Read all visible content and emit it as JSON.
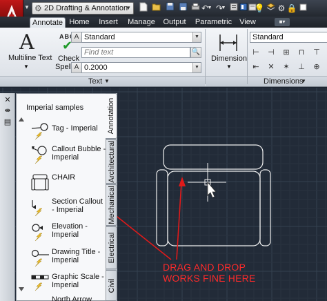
{
  "titlebar": {
    "workspace": "2D Drafting & Annotation",
    "app_letter": "A",
    "quick_access_icons": [
      "new-icon",
      "open-icon",
      "save-icon",
      "save-as-icon",
      "print-icon",
      "undo-icon",
      "redo-icon",
      "properties-icon",
      "tool-palettes-icon",
      "sheet-set-icon",
      "layers-icon",
      "bulb-icon",
      "settings-icon",
      "lock-icon",
      "square-icon"
    ]
  },
  "ribbon": {
    "tabs": [
      {
        "label": "Annotate",
        "active": true
      },
      {
        "label": "Home",
        "active": false
      },
      {
        "label": "Insert",
        "active": false
      },
      {
        "label": "Manage",
        "active": false
      },
      {
        "label": "Output",
        "active": false
      },
      {
        "label": "Parametric",
        "active": false
      },
      {
        "label": "View",
        "active": false
      }
    ],
    "text_panel": {
      "title": "Text",
      "multiline_label": "Multiline Text",
      "check_label": "Check",
      "spelling_label": "Spelling",
      "spell_abc": "ABC",
      "style_value": "Standard",
      "find_placeholder": "Find text",
      "height_value": "0.2000"
    },
    "dimensions_panel": {
      "title": "Dimensions",
      "dimension_label": "Dimension",
      "style_value": "Standard"
    }
  },
  "palette": {
    "header": "Imperial samples",
    "items": [
      {
        "label": "Tag - Imperial"
      },
      {
        "label": "Callout Bubble - Imperial"
      },
      {
        "label": "CHAIR"
      },
      {
        "label": "Section Callout - Imperial"
      },
      {
        "label": "Elevation - Imperial"
      },
      {
        "label": "Drawing Title - Imperial"
      },
      {
        "label": "Graphic Scale - Imperial"
      },
      {
        "label": "North Arrow"
      }
    ],
    "tabs": [
      "Annotation",
      "Architectural",
      "Mechanical",
      "Electrical",
      "Civil"
    ]
  },
  "annotation": {
    "line1": "DRAG AND DROP",
    "line2": "WORKS FINE HERE",
    "color": "#ff2a2a"
  }
}
